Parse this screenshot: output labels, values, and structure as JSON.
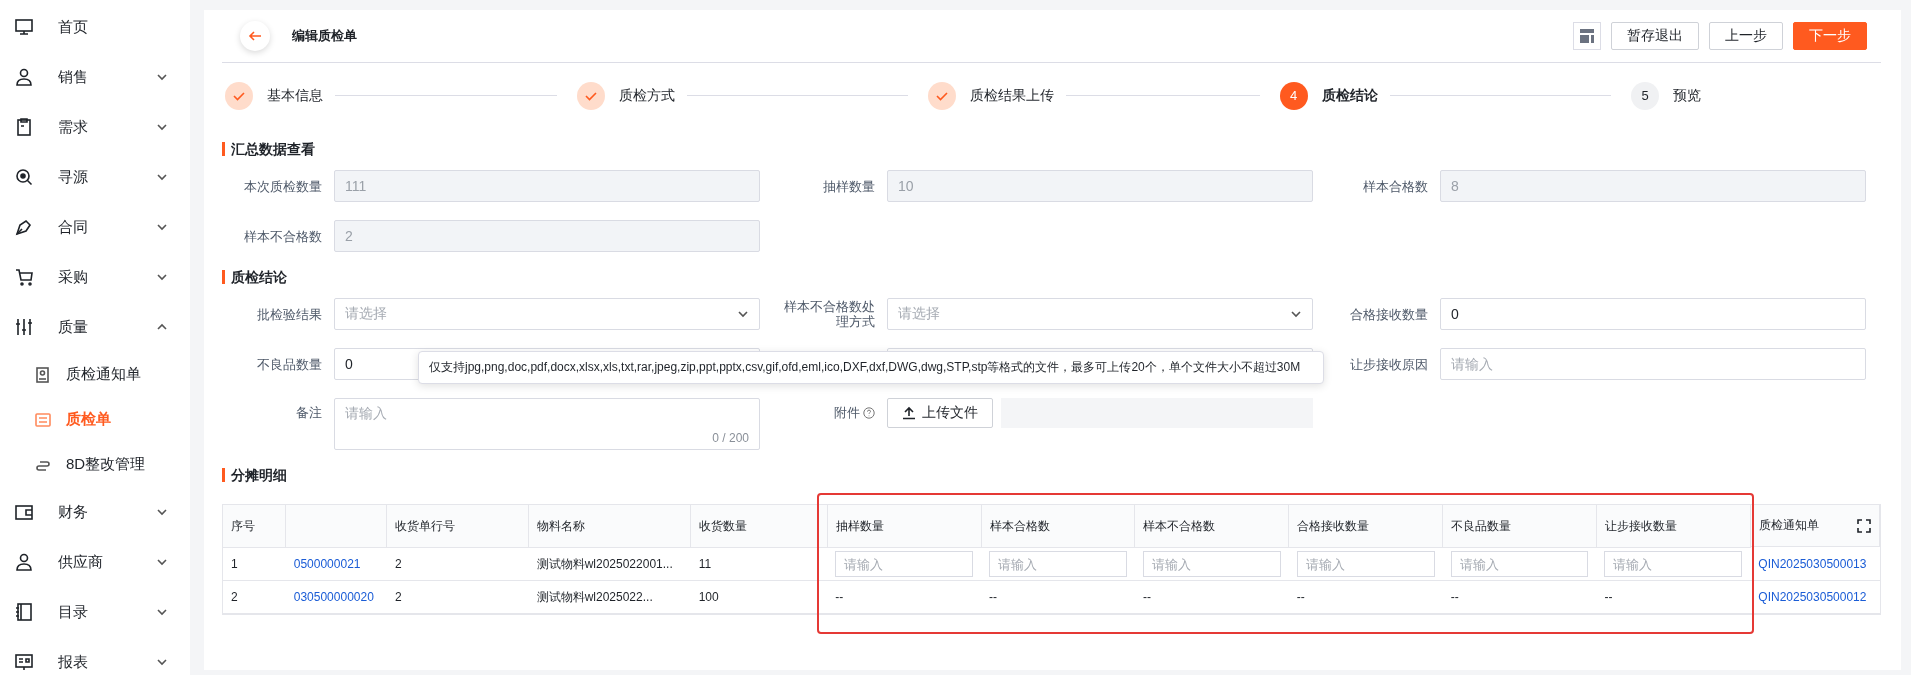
{
  "sidebar": {
    "items": [
      {
        "label": "首页"
      },
      {
        "label": "销售",
        "expanded": false
      },
      {
        "label": "需求",
        "expanded": false
      },
      {
        "label": "寻源",
        "expanded": false
      },
      {
        "label": "合同",
        "expanded": false
      },
      {
        "label": "采购",
        "expanded": false
      },
      {
        "label": "质量",
        "expanded": true,
        "children": [
          {
            "label": "质检通知单",
            "selected": false
          },
          {
            "label": "质检单",
            "selected": true
          },
          {
            "label": "8D整改管理",
            "selected": false
          }
        ]
      },
      {
        "label": "财务",
        "expanded": false
      },
      {
        "label": "供应商",
        "expanded": false
      },
      {
        "label": "目录",
        "expanded": false
      },
      {
        "label": "报表",
        "expanded": false
      }
    ]
  },
  "header": {
    "title": "编辑质检单",
    "buttons": [
      {
        "label": "暂存退出",
        "primary": false
      },
      {
        "label": "上一步",
        "primary": false
      },
      {
        "label": "下一步",
        "primary": true
      }
    ]
  },
  "steps": [
    {
      "label": "基本信息",
      "done": true,
      "current": false
    },
    {
      "label": "质检方式",
      "done": true,
      "current": false
    },
    {
      "label": "质检结果上传",
      "done": true,
      "current": false
    },
    {
      "number": "4",
      "label": "质检结论",
      "done": false,
      "current": true
    },
    {
      "number": "5",
      "label": "预览",
      "done": false,
      "current": false
    }
  ],
  "summary": {
    "title": "汇总数据查看",
    "fields": [
      {
        "label": "本次质检数量",
        "value": "111",
        "disabled": true
      },
      {
        "label": "抽样数量",
        "value": "10",
        "disabled": true
      },
      {
        "label": "样本合格数",
        "value": "8",
        "disabled": true
      },
      {
        "label": "样本不合格数",
        "value": "2",
        "disabled": true
      }
    ]
  },
  "conclusion": {
    "title": "质检结论",
    "fields": [
      {
        "kind": "select",
        "label": "批检验结果",
        "placeholder": "请选择"
      },
      {
        "kind": "select",
        "label": "样本不合格数处理方式",
        "placeholder": "请选择"
      },
      {
        "kind": "input",
        "label": "合格接收数量",
        "value": "0"
      },
      {
        "kind": "input",
        "label": "不良品数量",
        "value": "0"
      },
      {
        "kind": "covered"
      },
      {
        "kind": "input",
        "label": "让步接收原因",
        "placeholder": "请输入"
      },
      {
        "kind": "textarea",
        "label": "备注",
        "placeholder": "请输入",
        "counter": "0 / 200"
      },
      {
        "kind": "upload",
        "label": "附件",
        "button": "上传文件"
      }
    ],
    "tooltip": "仅支持jpg,png,doc,pdf,docx,xlsx,xls,txt,rar,jpeg,zip,ppt,pptx,csv,gif,ofd,eml,ico,DXF,dxf,DWG,dwg,STP,stp等格式的文件，最多可上传20个，单个文件大小不超过30M"
  },
  "allocation": {
    "title": "分摊明细",
    "table": {
      "columns": [
        {
          "label": "序号"
        },
        {},
        {
          "label": "收货单行号"
        },
        {
          "label": "物料名称"
        },
        {
          "label": "收货数量"
        },
        {
          "label": "抽样数量",
          "highlighted": true
        },
        {
          "label": "样本合格数",
          "highlighted": true
        },
        {
          "label": "样本不合格数",
          "highlighted": true
        },
        {
          "label": "合格接收数量",
          "highlighted": true
        },
        {
          "label": "不良品数量",
          "highlighted": true
        },
        {
          "label": "让步接收数量",
          "highlighted": true
        },
        {
          "label": "质检通知单"
        }
      ],
      "rows": [
        [
          {
            "text": "1"
          },
          {
            "kind": "link",
            "text": "0500000021"
          },
          {
            "text": "2"
          },
          {
            "text": "测试物料wl2025022001..."
          },
          {
            "text": "11"
          },
          {
            "kind": "input",
            "placeholder": "请输入"
          },
          {
            "kind": "input",
            "placeholder": "请输入"
          },
          {
            "kind": "input",
            "placeholder": "请输入"
          },
          {
            "kind": "input",
            "placeholder": "请输入"
          },
          {
            "kind": "input",
            "placeholder": "请输入"
          },
          {
            "kind": "input",
            "placeholder": "请输入"
          },
          {
            "kind": "link",
            "text": "QIN2025030500013"
          }
        ],
        [
          {
            "text": "2"
          },
          {
            "kind": "link",
            "text": "030500000020"
          },
          {
            "text": "2"
          },
          {
            "text": "测试物料wl2025022..."
          },
          {
            "text": "100"
          },
          {
            "text": "--"
          },
          {
            "text": "--"
          },
          {
            "text": "--"
          },
          {
            "text": "--"
          },
          {
            "text": "--"
          },
          {
            "text": "--"
          },
          {
            "kind": "link",
            "text": "QIN2025030500012"
          }
        ]
      ]
    }
  }
}
